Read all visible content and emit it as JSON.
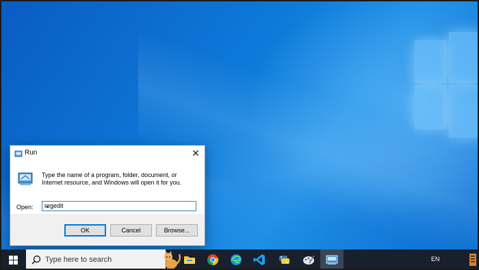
{
  "dialog": {
    "title": "Run",
    "description": "Type the name of a program, folder, document, or Internet resource, and Windows will open it for you.",
    "open_label": "Open:",
    "open_value": "regedit",
    "buttons": {
      "ok": "OK",
      "cancel": "Cancel",
      "browse": "Browse..."
    }
  },
  "taskbar": {
    "search_placeholder": "Type here to search",
    "apps": [
      "file-explorer",
      "chrome",
      "edge",
      "vscode",
      "python",
      "paint",
      "run"
    ],
    "language": "EN"
  },
  "colors": {
    "accent": "#0078d7",
    "taskbar": "#17202c",
    "desktop": "#0d7ad9"
  }
}
